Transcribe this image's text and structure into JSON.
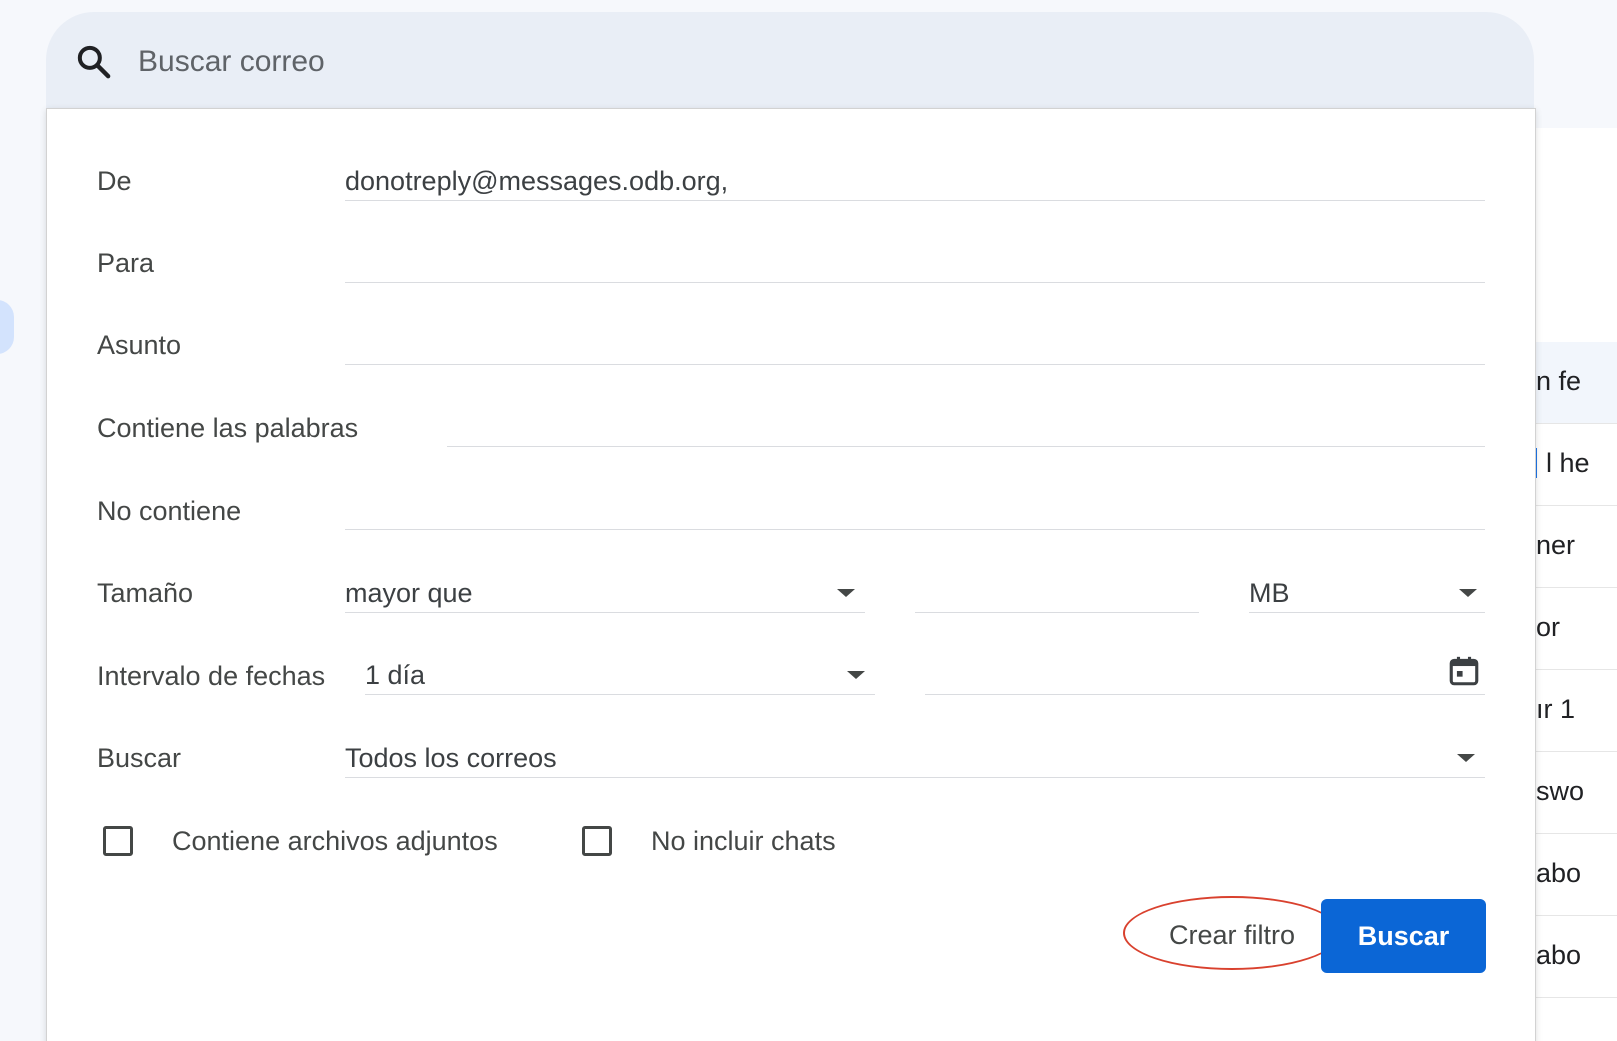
{
  "search": {
    "placeholder": "Buscar correo",
    "icon": "search-icon"
  },
  "form": {
    "from": {
      "label": "De",
      "value": "donotreply@messages.odb.org,"
    },
    "to": {
      "label": "Para",
      "value": ""
    },
    "subject": {
      "label": "Asunto",
      "value": ""
    },
    "has_words": {
      "label": "Contiene las palabras",
      "value": ""
    },
    "doesnt_have": {
      "label": "No contiene",
      "value": ""
    },
    "size": {
      "label": "Tamaño",
      "operator": "mayor que",
      "amount": "",
      "unit": "MB"
    },
    "date_within": {
      "label": "Intervalo de fechas",
      "value": "1 día",
      "date": ""
    },
    "search_in": {
      "label": "Buscar",
      "value": "Todos los correos"
    },
    "has_attachment": {
      "label": "Contiene archivos adjuntos",
      "checked": false
    },
    "exclude_chats": {
      "label": "No incluir chats",
      "checked": false
    }
  },
  "actions": {
    "create_filter": "Crear filtro",
    "search": "Buscar"
  },
  "background_list": {
    "rows": [
      "n fe",
      "l he",
      "ner",
      "or",
      "ır 1",
      "swo",
      "abo",
      "abo"
    ]
  },
  "colors": {
    "primary": "#0b66d6",
    "highlight_circle": "#d9412e",
    "search_bg": "#e9eef6"
  }
}
